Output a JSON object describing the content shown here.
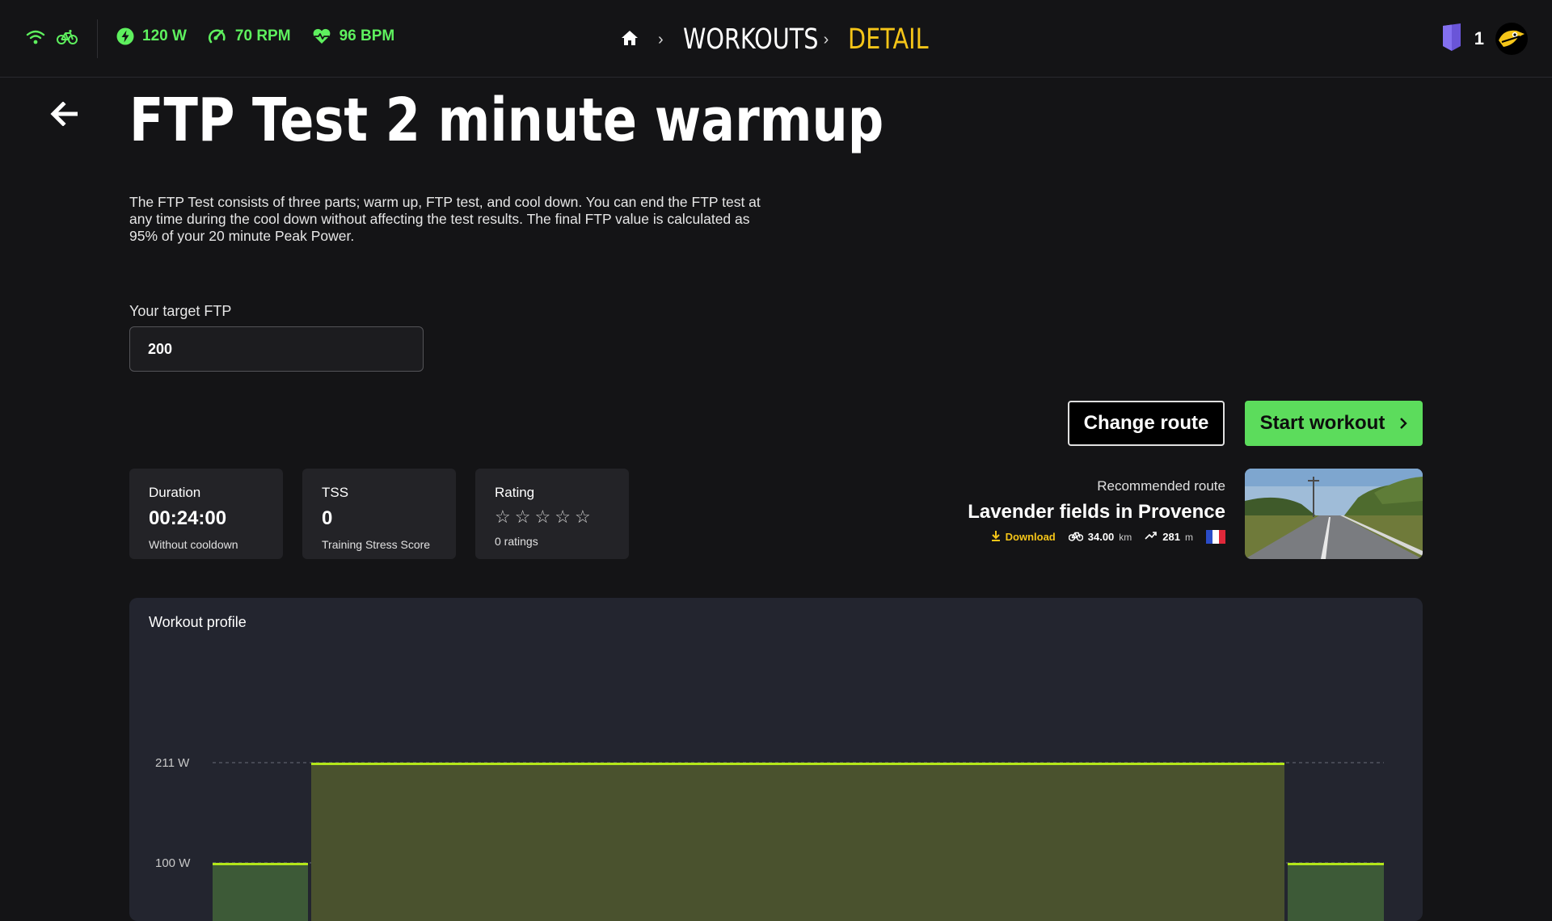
{
  "header": {
    "metrics": [
      {
        "icon": "power-bolt-icon",
        "value": "120 W"
      },
      {
        "icon": "cadence-gauge-icon",
        "value": "70 RPM"
      },
      {
        "icon": "heart-rate-icon",
        "value": "96 BPM"
      }
    ],
    "breadcrumb": {
      "section": "WORKOUTS",
      "current": "DETAIL"
    },
    "badge_count": "1"
  },
  "workout": {
    "title": "FTP Test 2 minute warmup",
    "description": "The FTP Test consists of three parts; warm up, FTP test, and cool down. You can end the FTP test at any time during the cool down without affecting the test results. The final FTP value is calculated as 95% of your 20 minute Peak Power.",
    "ftp_label": "Your target FTP",
    "ftp_value": "200"
  },
  "actions": {
    "change_route": "Change route",
    "start_workout": "Start workout"
  },
  "stats": {
    "duration": {
      "label": "Duration",
      "value": "00:24:00",
      "sub": "Without cooldown"
    },
    "tss": {
      "label": "TSS",
      "value": "0",
      "sub": "Training Stress Score"
    },
    "rating": {
      "label": "Rating",
      "value": 0,
      "max": 5,
      "sub": "0 ratings"
    }
  },
  "route": {
    "label": "Recommended route",
    "name": "Lavender fields in Provence",
    "download": "Download",
    "distance": "34.00",
    "distance_unit": "km",
    "elevation": "281",
    "elevation_unit": "m",
    "country_flag": "france-flag-icon"
  },
  "profile": {
    "title": "Workout profile"
  },
  "colors": {
    "accent_green": "#5cdc5c",
    "accent_yellow": "#f5c518",
    "line_green": "#b3e61a"
  },
  "chart_data": {
    "type": "area",
    "y_ticks": [
      "211 W",
      "100 W"
    ],
    "y_tick_values": [
      211,
      100
    ],
    "segments": [
      {
        "power": 100,
        "color": "#3d5a37"
      },
      {
        "power": 211,
        "color": "#4a522e"
      },
      {
        "power": 100,
        "color": "#3d5a37"
      }
    ]
  }
}
